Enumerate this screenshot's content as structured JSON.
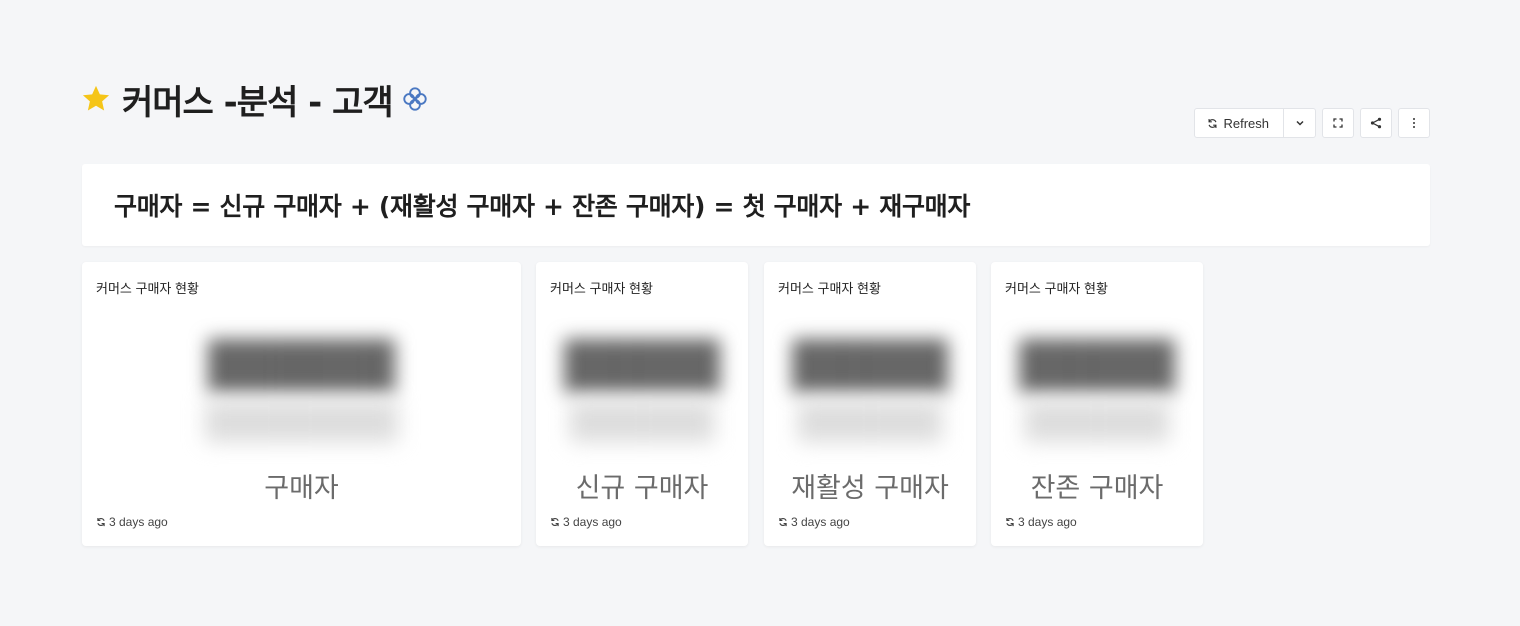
{
  "header": {
    "title": "커머스 -분석 - 고객",
    "star_color": "#F5C518",
    "cert_color": "#4A78C2"
  },
  "toolbar": {
    "refresh_label": "Refresh"
  },
  "formula": "구매자 = 신규 구매자 + (재활성 구매자 + 잔존 구매자) = 첫 구매자 + 재구매자",
  "cards": [
    {
      "title": "커머스 구매자 현황",
      "label": "구매자",
      "updated": "3 days ago"
    },
    {
      "title": "커머스 구매자 현황",
      "label": "신규 구매자",
      "updated": "3 days ago"
    },
    {
      "title": "커머스 구매자 현황",
      "label": "재활성 구매자",
      "updated": "3 days ago"
    },
    {
      "title": "커머스 구매자 현황",
      "label": "잔존 구매자",
      "updated": "3 days ago"
    }
  ]
}
